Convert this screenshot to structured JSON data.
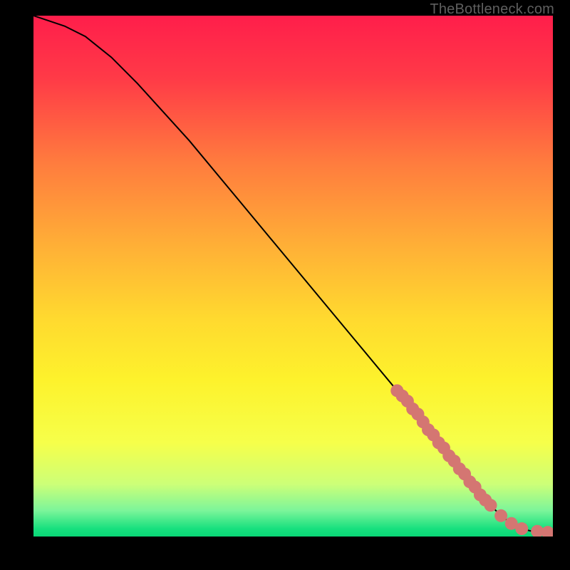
{
  "attribution": "TheBottleneck.com",
  "chart_data": {
    "type": "line",
    "title": "",
    "xlabel": "",
    "ylabel": "",
    "xlim": [
      0,
      100
    ],
    "ylim": [
      0,
      100
    ],
    "curve": {
      "x": [
        0,
        3,
        6,
        10,
        15,
        20,
        30,
        40,
        50,
        60,
        70,
        78,
        82,
        86,
        88,
        90,
        92,
        94,
        96,
        98,
        100
      ],
      "y": [
        100,
        99,
        98,
        96,
        92,
        87,
        76,
        64,
        52,
        40,
        28,
        18,
        13,
        8,
        6,
        4,
        2.5,
        1.5,
        1.0,
        0.8,
        0.8
      ]
    },
    "highlight_points": {
      "note": "dense pink markers appear along the lower-right portion of the curve",
      "x": [
        70,
        71,
        72,
        73,
        74,
        75,
        76,
        77,
        78,
        79,
        80,
        81,
        82,
        83,
        84,
        85,
        86,
        87,
        88,
        90,
        92,
        94,
        97,
        99
      ],
      "y": [
        28,
        27,
        26,
        24.5,
        23.5,
        22,
        20.5,
        19.5,
        18,
        17,
        15.5,
        14.5,
        13,
        12,
        10.5,
        9.5,
        8,
        7,
        6.0,
        4.0,
        2.5,
        1.5,
        1.0,
        0.8
      ]
    },
    "gradient_stops": [
      {
        "pos": 0.0,
        "color": "#ff1e4b"
      },
      {
        "pos": 0.12,
        "color": "#ff3a47"
      },
      {
        "pos": 0.28,
        "color": "#ff7b3e"
      },
      {
        "pos": 0.45,
        "color": "#ffb236"
      },
      {
        "pos": 0.58,
        "color": "#ffd92f"
      },
      {
        "pos": 0.7,
        "color": "#fdf22c"
      },
      {
        "pos": 0.82,
        "color": "#f6ff4a"
      },
      {
        "pos": 0.9,
        "color": "#ccff78"
      },
      {
        "pos": 0.95,
        "color": "#7cf59a"
      },
      {
        "pos": 0.985,
        "color": "#17e07e"
      },
      {
        "pos": 1.0,
        "color": "#0ad777"
      }
    ],
    "marker_color": "#d47672",
    "curve_color": "#000000"
  }
}
